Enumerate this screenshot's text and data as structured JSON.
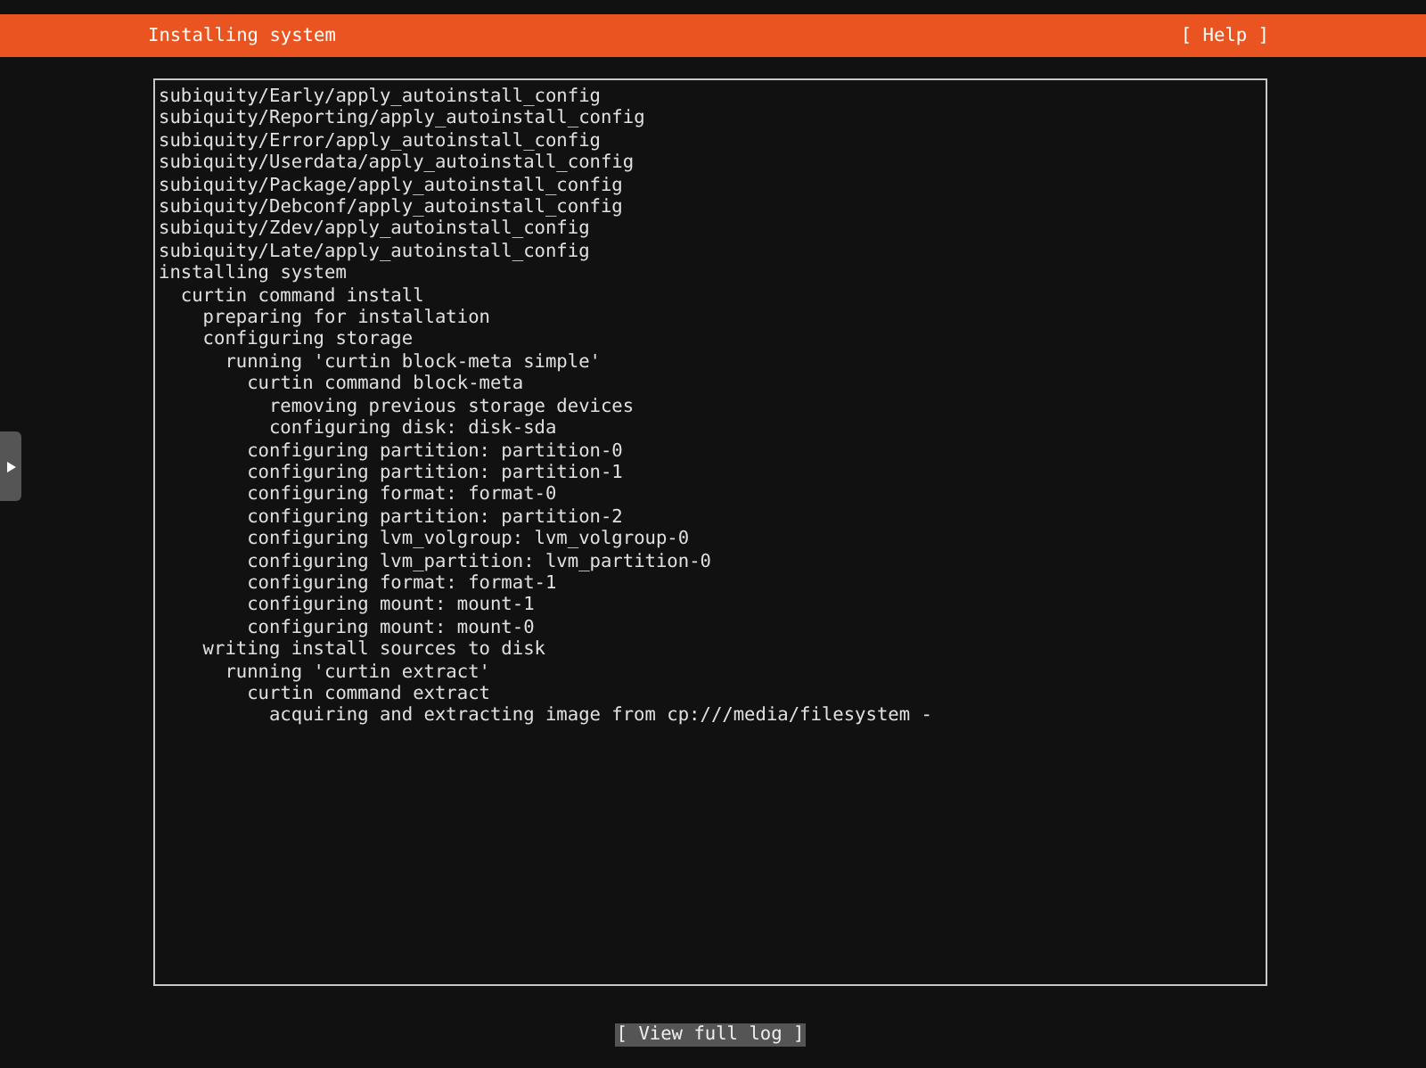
{
  "header": {
    "title": "Installing system",
    "help": "[ Help ]"
  },
  "log": [
    {
      "text": "subiquity/Early/apply_autoinstall_config"
    },
    {
      "text": "subiquity/Reporting/apply_autoinstall_config"
    },
    {
      "text": "subiquity/Error/apply_autoinstall_config"
    },
    {
      "text": "subiquity/Userdata/apply_autoinstall_config"
    },
    {
      "text": "subiquity/Package/apply_autoinstall_config"
    },
    {
      "text": "subiquity/Debconf/apply_autoinstall_config"
    },
    {
      "text": "subiquity/Zdev/apply_autoinstall_config"
    },
    {
      "text": "subiquity/Late/apply_autoinstall_config"
    },
    {
      "text": "installing system",
      "children": [
        {
          "text": "curtin command install",
          "children": [
            {
              "text": "preparing for installation"
            },
            {
              "text": "configuring storage",
              "children": [
                {
                  "text": "running 'curtin block-meta simple'",
                  "children": [
                    {
                      "text": "curtin command block-meta",
                      "children": [
                        {
                          "text": "removing previous storage devices"
                        },
                        {
                          "text": "configuring disk: disk-sda"
                        }
                      ]
                    },
                    {
                      "text": "configuring partition: partition-0"
                    },
                    {
                      "text": "configuring partition: partition-1"
                    },
                    {
                      "text": "configuring format: format-0"
                    },
                    {
                      "text": "configuring partition: partition-2"
                    },
                    {
                      "text": "configuring lvm_volgroup: lvm_volgroup-0"
                    },
                    {
                      "text": "configuring lvm_partition: lvm_partition-0"
                    },
                    {
                      "text": "configuring format: format-1"
                    },
                    {
                      "text": "configuring mount: mount-1"
                    },
                    {
                      "text": "configuring mount: mount-0"
                    }
                  ]
                }
              ]
            },
            {
              "text": "writing install sources to disk",
              "children": [
                {
                  "text": "running 'curtin extract'",
                  "children": [
                    {
                      "text": "curtin command extract",
                      "children": [
                        {
                          "text": "acquiring and extracting image from cp:///media/filesystem -"
                        }
                      ]
                    }
                  ]
                }
              ]
            }
          ]
        }
      ]
    }
  ],
  "button": "[ View full log ]"
}
